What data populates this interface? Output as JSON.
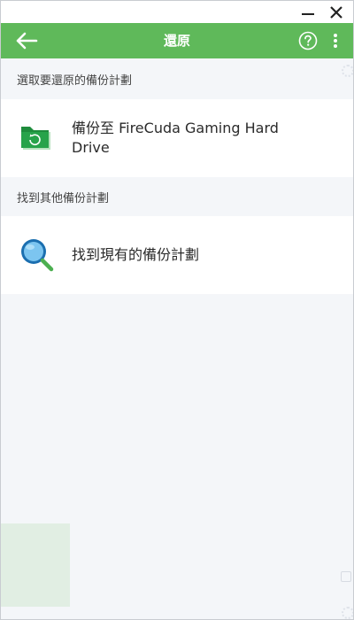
{
  "window": {
    "minimize_icon": "minimize-icon",
    "close_icon": "close-icon"
  },
  "appbar": {
    "title": "還原",
    "back_icon": "arrow-left-icon",
    "help_icon": "help-circle-icon",
    "more_icon": "more-vertical-icon",
    "bg_color": "#5fb95a"
  },
  "sections": [
    {
      "header": "選取要還原的備份計劃",
      "item": {
        "label": "備份至 FireCuda Gaming Hard Drive",
        "icon": "folder-restore-icon"
      }
    },
    {
      "header": "找到其他備份計劃",
      "item": {
        "label": "找到現有的備份計劃",
        "icon": "magnifier-icon"
      }
    }
  ]
}
